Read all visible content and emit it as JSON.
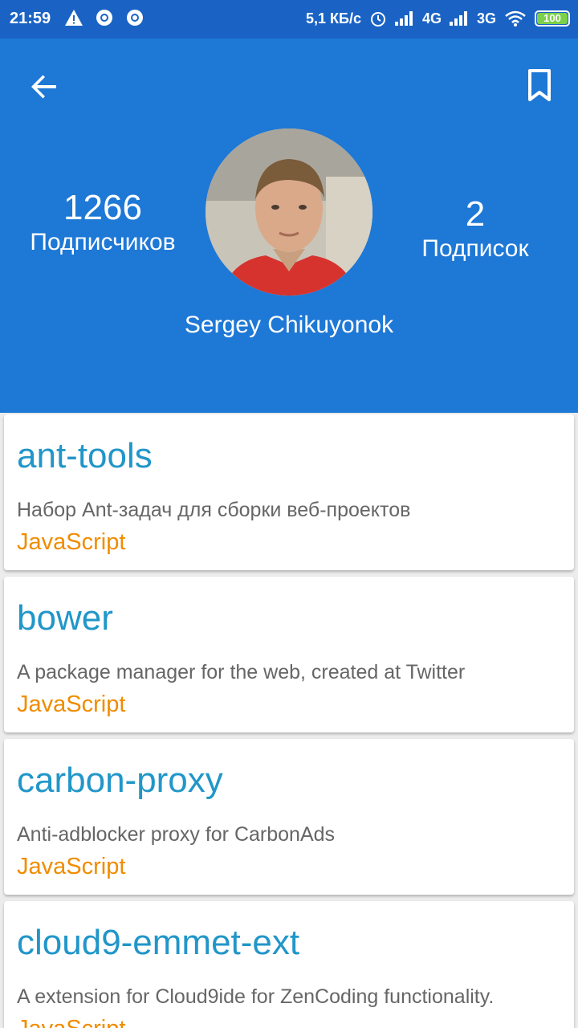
{
  "status_bar": {
    "time": "21:59",
    "speed": "5,1 КБ/с",
    "net1": "4G",
    "net2": "3G",
    "battery": "100",
    "icons": [
      "warning-icon",
      "circle-icon",
      "circle-icon",
      "alarm-icon",
      "signal-icon",
      "signal-icon",
      "wifi-icon",
      "battery-icon"
    ]
  },
  "profile": {
    "followers_count": "1266",
    "followers_label": "Подписчиков",
    "following_count": "2",
    "following_label": "Подписок",
    "name": "Sergey Chikuyonok",
    "header_color": "#1e78d6"
  },
  "repos": [
    {
      "name": "ant-tools",
      "description": "Набор Ant-задач для сборки веб-проектов",
      "language": "JavaScript"
    },
    {
      "name": "bower",
      "description": "A package manager for the web, created at Twitter",
      "language": "JavaScript"
    },
    {
      "name": "carbon-proxy",
      "description": "Anti-adblocker proxy for CarbonAds",
      "language": "JavaScript"
    },
    {
      "name": "cloud9-emmet-ext",
      "description": "A extension for Cloud9ide for ZenCoding functionality.",
      "language": "JavaScript"
    }
  ]
}
